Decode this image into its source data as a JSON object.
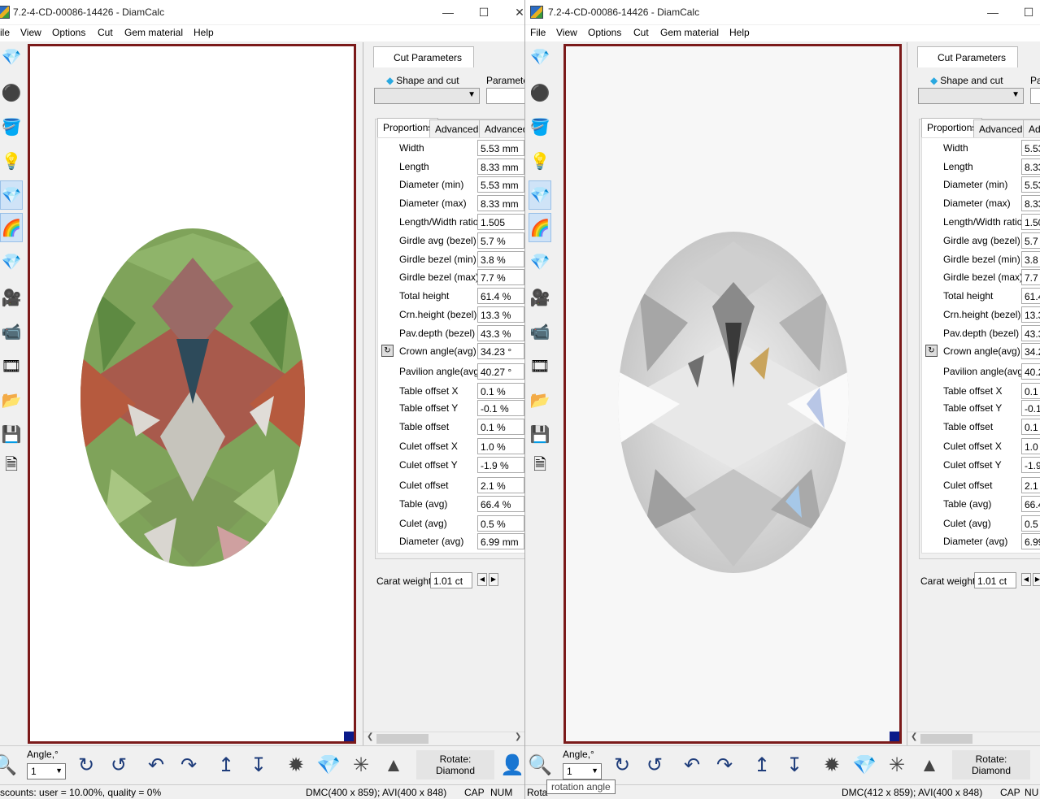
{
  "windows": [
    {
      "id": "left",
      "title": "7.2-4-CD-00086-14426 - DiamCalc",
      "menu": [
        "ile",
        "View",
        "Options",
        "Cut",
        "Gem material",
        "Help"
      ],
      "panel_tab": "Cut Parameters",
      "shape_label": "Shape and cut",
      "param_label": "Parameter",
      "subtabs": [
        "Proportions",
        "Advanced",
        "Advanced"
      ],
      "rows": [
        {
          "label": "Width",
          "value": "5.53 mm"
        },
        {
          "label": "Length",
          "value": "8.33 mm"
        },
        {
          "label": "Diameter (min)",
          "value": "5.53 mm"
        },
        {
          "label": "Diameter (max)",
          "value": "8.33 mm"
        },
        {
          "label": "Length/Width ratio",
          "value": "1.505"
        },
        {
          "label": "Girdle avg (bezel)",
          "value": "5.7 %"
        },
        {
          "label": "Girdle bezel (min)",
          "value": "3.8 %"
        },
        {
          "label": "Girdle bezel (max)",
          "value": "7.7 %"
        },
        {
          "label": "Total height",
          "value": "61.4 %"
        },
        {
          "label": "Crn.height (bezel)",
          "value": "13.3 %"
        },
        {
          "label": "Pav.depth (bezel)",
          "value": "43.3 %"
        },
        {
          "label": "Crown angle(avg)",
          "value": "34.23 °"
        },
        {
          "label": "Pavilion angle(avg)",
          "value": "40.27 °"
        },
        {
          "label": "Table offset X",
          "value": "0.1 %"
        },
        {
          "label": "Table offset Y",
          "value": "-0.1 %"
        },
        {
          "label": "Table offset",
          "value": "0.1 %"
        },
        {
          "label": "Culet offset X",
          "value": "1.0 %"
        },
        {
          "label": "Culet offset Y",
          "value": "-1.9 %"
        },
        {
          "label": "Culet offset",
          "value": "2.1 %"
        },
        {
          "label": "Table (avg)",
          "value": "66.4 %"
        },
        {
          "label": "Culet (avg)",
          "value": "0.5 %"
        },
        {
          "label": "Diameter (avg)",
          "value": "6.99 mm"
        }
      ],
      "carat_label": "Carat weight",
      "carat_value": "1.01 ct",
      "angle_label": "Angle,°",
      "angle_value": "1",
      "rotate_label": "Rotate:",
      "rotate_value": "Diamond",
      "status": [
        "scounts: user = 10.00%, quality = 0%",
        "DMC(400 x 859); AVI(400 x 848)",
        "CAP",
        "NUM"
      ]
    },
    {
      "id": "right",
      "title": "7.2-4-CD-00086-14426 - DiamCalc",
      "menu": [
        "File",
        "View",
        "Options",
        "Cut",
        "Gem material",
        "Help"
      ],
      "panel_tab": "Cut Parameters",
      "shape_label": "Shape and cut",
      "param_label": "Pa",
      "subtabs": [
        "Proportions",
        "Advanced",
        "Adv"
      ],
      "rows": [
        {
          "label": "Width",
          "value": "5.53"
        },
        {
          "label": "Length",
          "value": "8.33"
        },
        {
          "label": "Diameter (min)",
          "value": "5.53"
        },
        {
          "label": "Diameter (max)",
          "value": "8.33"
        },
        {
          "label": "Length/Width ratio",
          "value": "1.50"
        },
        {
          "label": "Girdle avg (bezel)",
          "value": "5.7"
        },
        {
          "label": "Girdle bezel (min)",
          "value": "3.8"
        },
        {
          "label": "Girdle bezel (max)",
          "value": "7.7"
        },
        {
          "label": "Total height",
          "value": "61.4"
        },
        {
          "label": "Crn.height (bezel)",
          "value": "13.3"
        },
        {
          "label": "Pav.depth (bezel)",
          "value": "43.3"
        },
        {
          "label": "Crown angle(avg)",
          "value": "34.2"
        },
        {
          "label": "Pavilion angle(avg)",
          "value": "40.2"
        },
        {
          "label": "Table offset X",
          "value": "0.1"
        },
        {
          "label": "Table offset Y",
          "value": "-0.1"
        },
        {
          "label": "Table offset",
          "value": "0.1"
        },
        {
          "label": "Culet offset X",
          "value": "1.0"
        },
        {
          "label": "Culet offset Y",
          "value": "-1.9"
        },
        {
          "label": "Culet offset",
          "value": "2.1"
        },
        {
          "label": "Table (avg)",
          "value": "66.4"
        },
        {
          "label": "Culet (avg)",
          "value": "0.5"
        },
        {
          "label": "Diameter (avg)",
          "value": "6.99"
        }
      ],
      "carat_label": "Carat weight",
      "carat_value": "1.01 ct",
      "angle_label": "Angle,°",
      "angle_value": "1",
      "rotate_label": "Rotate:",
      "rotate_value": "Diamond",
      "status": [
        "Rota",
        "DMC(412 x 859); AVI(400 x 848)",
        "CAP",
        "NU"
      ]
    }
  ],
  "tooltip": "rotation angle",
  "colors": {
    "viewport_border": "#7b1a1a",
    "accent": "#29a8e0"
  }
}
